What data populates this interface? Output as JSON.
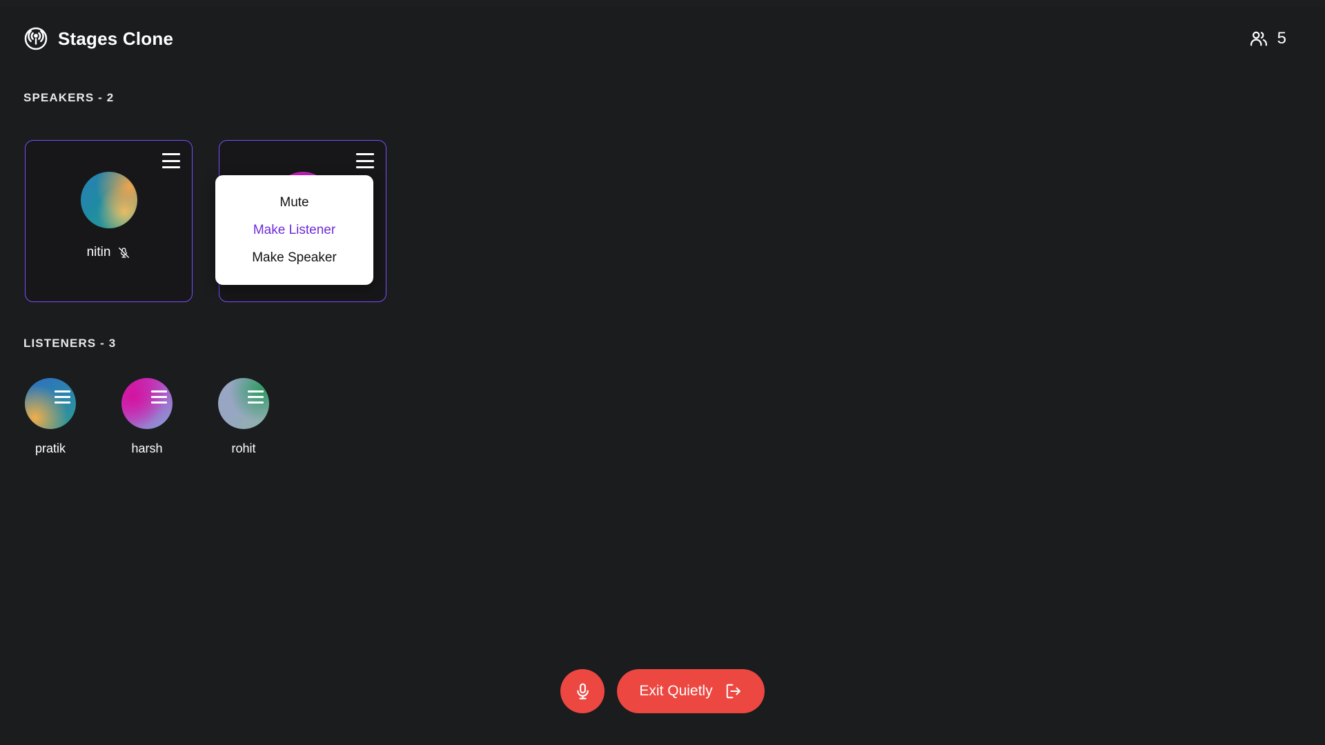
{
  "app": {
    "background_color": "#1a1c1e",
    "accent_purple": "#7c4dff",
    "accent_red": "#ec4740",
    "menu_highlight_color": "#6f2bd8"
  },
  "header": {
    "logo_icon": "podcast-broadcast-icon",
    "title": "Stages Clone",
    "people_icon": "people-group-icon",
    "people_count": "5"
  },
  "speakers_section": {
    "label": "SPEAKERS - 2",
    "cards": [
      {
        "name": "nitin",
        "menu_icon": "hamburger-menu-icon",
        "mic_icon": "mic-off-icon",
        "muted": true,
        "avatar_style": "avatar-teal"
      },
      {
        "name": "",
        "menu_icon": "hamburger-menu-icon",
        "mic_icon": "",
        "muted": false,
        "avatar_style": "avatar-magenta"
      }
    ]
  },
  "dropdown": {
    "visible": true,
    "items": [
      {
        "label": "Mute",
        "active": false
      },
      {
        "label": "Make Listener",
        "active": true
      },
      {
        "label": "Make Speaker",
        "active": false
      }
    ]
  },
  "listeners_section": {
    "label": "LISTENERS - 3",
    "listeners": [
      {
        "name": "pratik",
        "menu_icon": "hamburger-menu-icon",
        "avatar_style": "avatar-blueorange"
      },
      {
        "name": "harsh",
        "menu_icon": "hamburger-menu-icon",
        "avatar_style": "avatar-pinkblue"
      },
      {
        "name": "rohit",
        "menu_icon": "hamburger-menu-icon",
        "avatar_style": "avatar-slate"
      }
    ]
  },
  "bottom_bar": {
    "mic_button": {
      "icon": "microphone-icon",
      "label": ""
    },
    "exit_button": {
      "label": "Exit Quietly",
      "icon": "logout-arrow-icon"
    }
  }
}
